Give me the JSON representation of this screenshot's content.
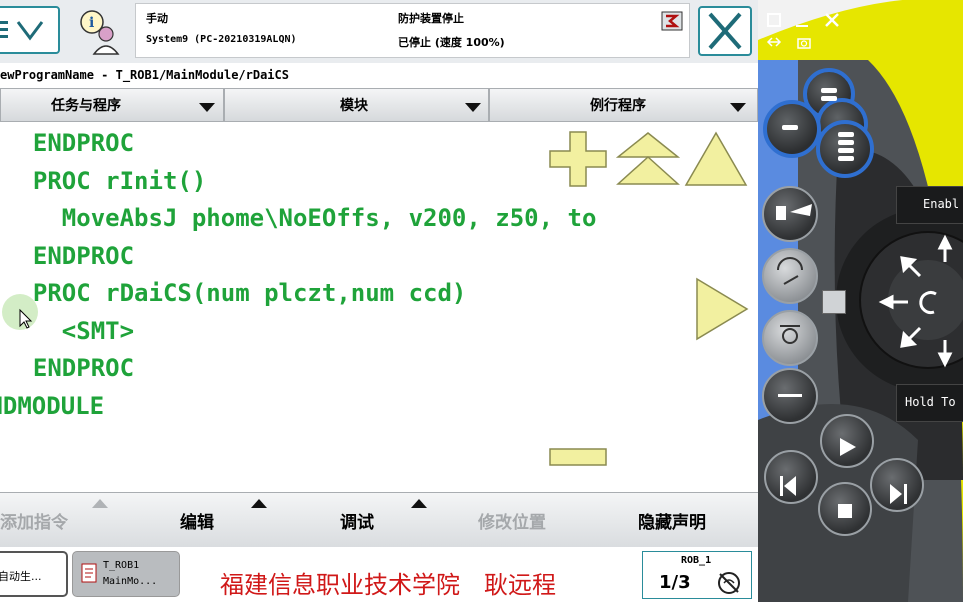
{
  "status": {
    "mode": "手动",
    "system": "System9 (PC-20210319ALQN)",
    "guard": "防护装置停止",
    "state": "已停止 (速度 100%)"
  },
  "path": "ewProgramName - T_ROB1/MainModule/rDaiCS",
  "tabs": [
    "任务与程序",
    "模块",
    "例行程序"
  ],
  "code_lines": [
    "  ENDPROC",
    "  PROC rInit()",
    "    MoveAbsJ phome\\NoEOffs, v200, z50, to",
    "  ENDPROC",
    "  PROC rDaiCS(num plczt,num ccd)",
    "    <SMT>",
    "  ENDPROC",
    "ENDMODULE"
  ],
  "bottom_buttons": [
    "添加指令",
    "编辑",
    "调试",
    "修改位置",
    "隐藏声明"
  ],
  "taskbar": {
    "task1": "自动生...",
    "task2_line1": "T_ROB1",
    "task2_line2": "MainMo...",
    "school": "福建信息职业技术学院　耿远程",
    "rob_label": "ROB_1",
    "fraction": "1/3"
  },
  "pendant": {
    "enable_label": "Enabl",
    "hold_label": "Hold To"
  },
  "colors": {
    "code_green": "#1fa33a",
    "accent_teal": "#2a8c9a",
    "zoom_yellow": "#f2f0a0",
    "school_red": "#d01818",
    "pendant_blue": "#2f6fd0"
  }
}
